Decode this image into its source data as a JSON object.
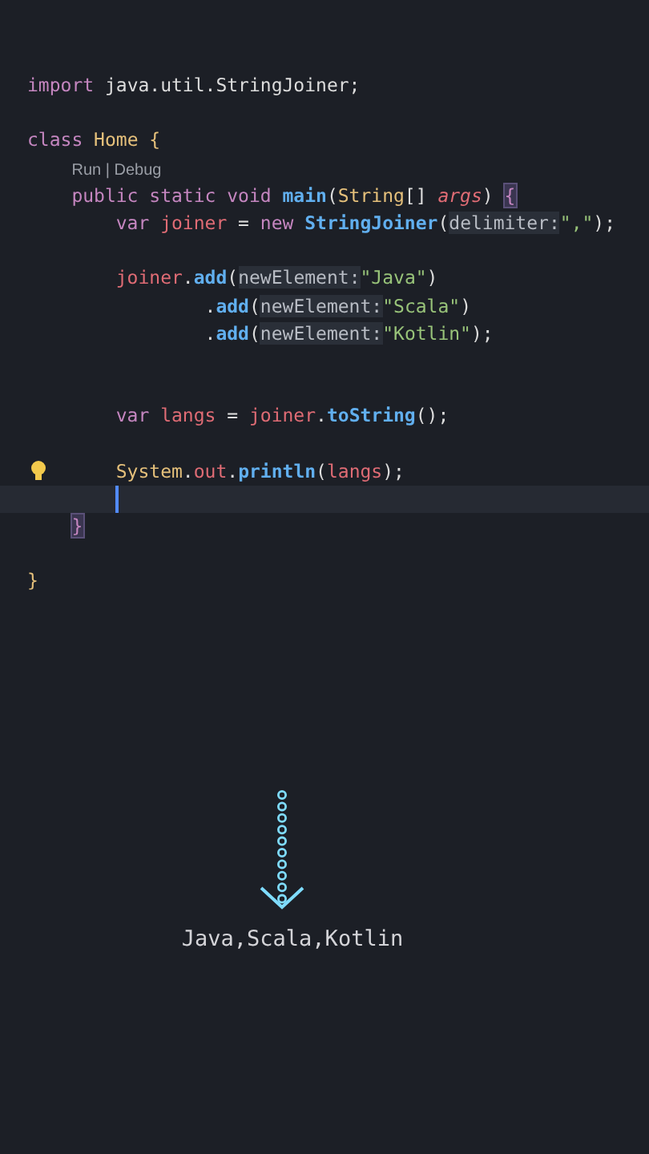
{
  "editor": {
    "lines": [
      {
        "kind": "code",
        "tokens": [
          {
            "text": "import",
            "kind": "keyword"
          },
          {
            "text": " java.util.StringJoiner;",
            "kind": "plain"
          }
        ]
      },
      {
        "kind": "blank"
      },
      {
        "kind": "code",
        "tokens": [
          {
            "text": "class",
            "kind": "keyword"
          },
          {
            "text": " Home",
            "kind": "type"
          },
          {
            "text": " {",
            "kind": "type"
          }
        ]
      },
      {
        "kind": "codelens",
        "text": "    Run | Debug"
      },
      {
        "kind": "code",
        "tokens": [
          {
            "text": "    public static void",
            "kind": "keyword"
          },
          {
            "text": " main",
            "kind": "method"
          },
          {
            "text": "(",
            "kind": "plain"
          },
          {
            "text": "String",
            "kind": "type"
          },
          {
            "text": "[] ",
            "kind": "plain"
          },
          {
            "text": "args",
            "kind": "param"
          },
          {
            "text": ") ",
            "kind": "plain"
          },
          {
            "text": "{",
            "kind": "bracket-match"
          }
        ]
      },
      {
        "kind": "code",
        "tokens": [
          {
            "text": "        var",
            "kind": "keyword"
          },
          {
            "text": " joiner",
            "kind": "variable"
          },
          {
            "text": " = ",
            "kind": "plain"
          },
          {
            "text": "new",
            "kind": "keyword"
          },
          {
            "text": " StringJoiner",
            "kind": "method"
          },
          {
            "text": "(",
            "kind": "plain"
          },
          {
            "text": "delimiter:",
            "kind": "hint"
          },
          {
            "text": "\",\"",
            "kind": "string"
          },
          {
            "text": ");",
            "kind": "plain"
          }
        ]
      },
      {
        "kind": "blank"
      },
      {
        "kind": "code",
        "tokens": [
          {
            "text": "        joiner",
            "kind": "variable"
          },
          {
            "text": ".",
            "kind": "plain"
          },
          {
            "text": "add",
            "kind": "method"
          },
          {
            "text": "(",
            "kind": "plain"
          },
          {
            "text": "newElement:",
            "kind": "hint"
          },
          {
            "text": "\"Java\"",
            "kind": "string"
          },
          {
            "text": ")",
            "kind": "plain"
          }
        ]
      },
      {
        "kind": "code",
        "tokens": [
          {
            "text": "                .",
            "kind": "plain"
          },
          {
            "text": "add",
            "kind": "method"
          },
          {
            "text": "(",
            "kind": "plain"
          },
          {
            "text": "newElement:",
            "kind": "hint"
          },
          {
            "text": "\"Scala\"",
            "kind": "string"
          },
          {
            "text": ")",
            "kind": "plain"
          }
        ]
      },
      {
        "kind": "code",
        "tokens": [
          {
            "text": "                .",
            "kind": "plain"
          },
          {
            "text": "add",
            "kind": "method"
          },
          {
            "text": "(",
            "kind": "plain"
          },
          {
            "text": "newElement:",
            "kind": "hint"
          },
          {
            "text": "\"Kotlin\"",
            "kind": "string"
          },
          {
            "text": ");",
            "kind": "plain"
          }
        ]
      },
      {
        "kind": "blank"
      },
      {
        "kind": "blank"
      },
      {
        "kind": "code",
        "tokens": [
          {
            "text": "        var",
            "kind": "keyword"
          },
          {
            "text": " langs",
            "kind": "variable"
          },
          {
            "text": " = ",
            "kind": "plain"
          },
          {
            "text": "joiner",
            "kind": "variable"
          },
          {
            "text": ".",
            "kind": "plain"
          },
          {
            "text": "toString",
            "kind": "method"
          },
          {
            "text": "();",
            "kind": "plain"
          }
        ]
      },
      {
        "kind": "blank"
      },
      {
        "kind": "bulb",
        "tokens": [
          {
            "text": "        System",
            "kind": "type"
          },
          {
            "text": ".",
            "kind": "plain"
          },
          {
            "text": "out",
            "kind": "variable"
          },
          {
            "text": ".",
            "kind": "plain"
          },
          {
            "text": "println",
            "kind": "method"
          },
          {
            "text": "(",
            "kind": "plain"
          },
          {
            "text": "langs",
            "kind": "variable"
          },
          {
            "text": ");",
            "kind": "plain"
          }
        ]
      },
      {
        "kind": "cursor"
      },
      {
        "kind": "code",
        "tokens": [
          {
            "text": "    }",
            "kind": "bracket-match"
          }
        ]
      },
      {
        "kind": "blank"
      },
      {
        "kind": "code",
        "tokens": [
          {
            "text": "}",
            "kind": "type"
          }
        ]
      }
    ]
  },
  "output": {
    "text": "Java,Scala,Kotlin"
  }
}
